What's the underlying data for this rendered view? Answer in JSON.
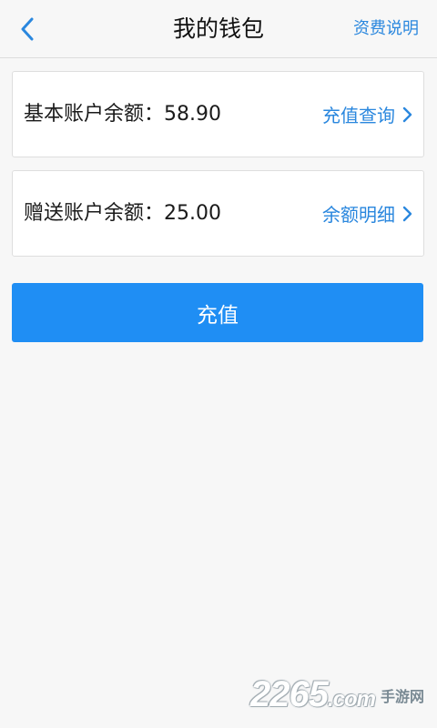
{
  "header": {
    "title": "我的钱包",
    "right_link": "资费说明"
  },
  "accounts": [
    {
      "label": "基本账户余额：58.90",
      "link": "充值查询"
    },
    {
      "label": "赠送账户余额：25.00",
      "link": "余额明细"
    }
  ],
  "recharge_button": "充值",
  "watermark": {
    "number": "2265",
    "domain": ".com",
    "text": "手游网"
  },
  "colors": {
    "accent": "#2a87de",
    "button": "#1f8ef4",
    "background": "#f7f7f7"
  }
}
